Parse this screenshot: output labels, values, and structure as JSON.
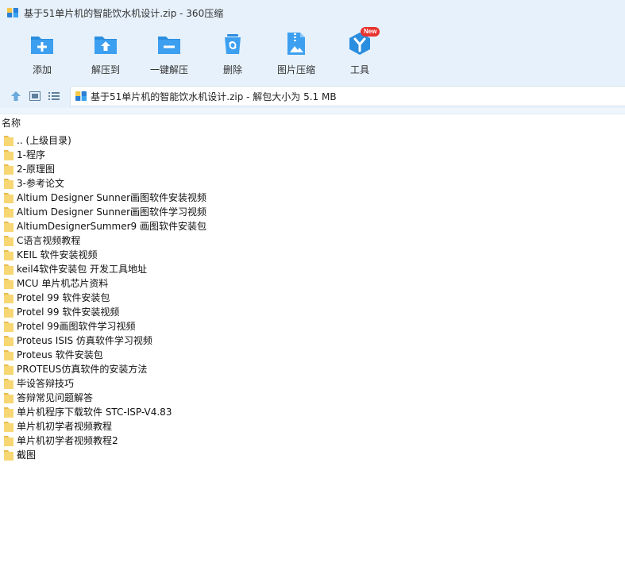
{
  "window": {
    "title": "基于51单片机的智能饮水机设计.zip - 360压缩"
  },
  "toolbar": {
    "items": [
      {
        "label": "添加",
        "icon": "add-icon"
      },
      {
        "label": "解压到",
        "icon": "extract-to-icon"
      },
      {
        "label": "一键解压",
        "icon": "one-click-extract-icon"
      },
      {
        "label": "删除",
        "icon": "delete-icon"
      },
      {
        "label": "图片压缩",
        "icon": "image-compress-icon"
      },
      {
        "label": "工具",
        "icon": "tools-icon",
        "badge": "New"
      }
    ]
  },
  "address": {
    "text": "基于51单片机的智能饮水机设计.zip - 解包大小为 5.1 MB"
  },
  "columns": {
    "name": "名称"
  },
  "files": [
    ".. (上级目录)",
    "1-程序",
    "2-原理图",
    "3-参考论文",
    "Altium Designer Sunner画图软件安装视频",
    "Altium Designer Sunner画图软件学习视频",
    "AltiumDesignerSummer9 画图软件安装包",
    "C语言视频教程",
    "KEIL 软件安装视频",
    "keil4软件安装包 开发工具地址",
    "MCU 单片机芯片资料",
    "Protel 99 软件安装包",
    "Protel 99 软件安装视频",
    "Protel 99画图软件学习视频",
    "Proteus ISIS  仿真软件学习视频",
    "Proteus 软件安装包",
    "PROTEUS仿真软件的安装方法",
    "毕设答辩技巧",
    "答辩常见问题解答",
    "单片机程序下载软件 STC-ISP-V4.83",
    "单片机初学者视频教程",
    "单片机初学者视频教程2",
    "截图"
  ],
  "colors": {
    "accent": "#2a8ee0",
    "folder": "#f7d774",
    "toolbar_bg": "#e6f1fb"
  }
}
